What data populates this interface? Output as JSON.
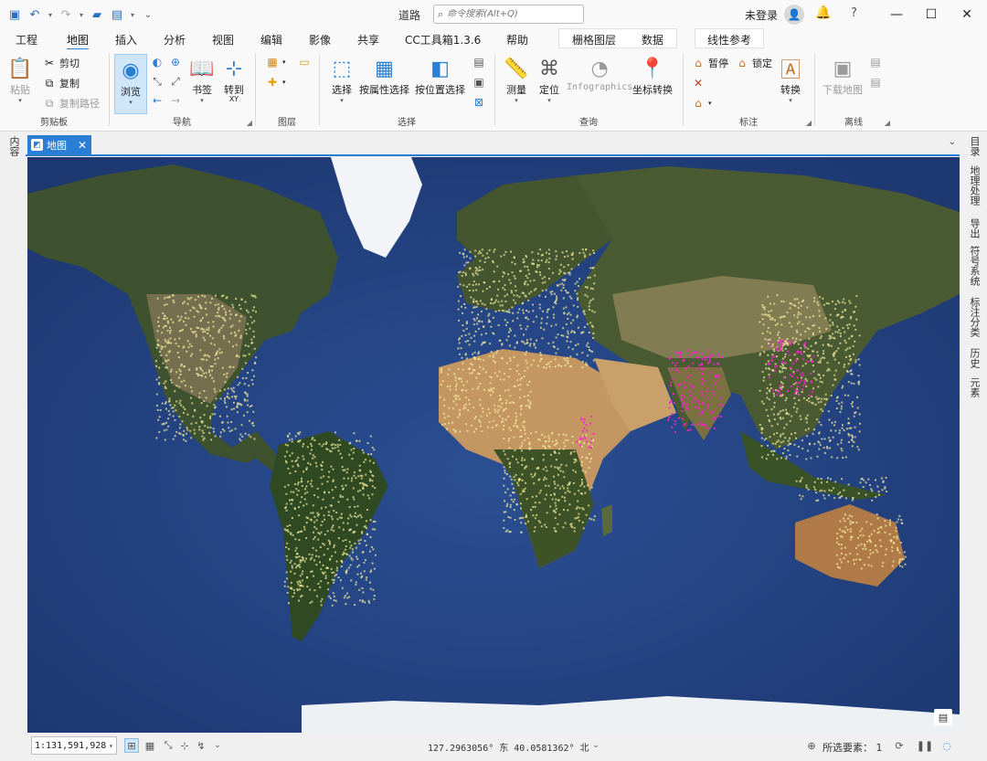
{
  "titlebar": {
    "title": "道路",
    "search_placeholder": "命令搜索(Alt+Q)",
    "login": "未登录",
    "icons": [
      "save-icon",
      "undo-icon",
      "redo-icon",
      "open-folder-icon",
      "new-project-icon",
      "customize-icon"
    ]
  },
  "menu": {
    "tabs": [
      "工程",
      "地图",
      "插入",
      "分析",
      "视图",
      "编辑",
      "影像",
      "共享",
      "CC工具箱1.3.6",
      "帮助"
    ],
    "active_tab": "地图",
    "context_tabs": [
      "栅格图层",
      "数据"
    ],
    "context_tab2": "线性参考"
  },
  "ribbon": {
    "clipboard": {
      "paste": "粘贴",
      "cut": "剪切",
      "copy": "复制",
      "copy_path": "复制路径",
      "label": "剪贴板"
    },
    "navigate": {
      "explore": "浏览",
      "bookmarks": "书签",
      "goto": "转到",
      "goto_sub": "XY",
      "label": "导航"
    },
    "layer": {
      "label": "图层"
    },
    "selection": {
      "select": "选择",
      "by_attr": "按属性选择",
      "by_loc": "按位置选择",
      "label": "选择"
    },
    "inquiry": {
      "measure": "测量",
      "locate": "定位",
      "infographics": "Infographics",
      "convert": "坐标转换",
      "label": "查询"
    },
    "labeling": {
      "pause": "暂停",
      "lock": "锁定",
      "convert": "转换",
      "label": "标注"
    },
    "offline": {
      "download": "下载地图",
      "label": "离线"
    }
  },
  "dock": {
    "left_label": "内容",
    "doc_tab": "地图",
    "right_labels": [
      "目录",
      "地理处理",
      "导出",
      "符号系统",
      "标注分类",
      "历史",
      "元素"
    ]
  },
  "status": {
    "scale": "1:131,591,928",
    "coordinates": "127.2963056° 东 40.0581362° 北",
    "selected_label": "所选要素：",
    "selected_count": "1"
  },
  "colors": {
    "accent": "#2a7fd4",
    "ocean": "#23407e",
    "land_forest": "#3a4f2c",
    "land_desert": "#b48a5a",
    "road_points": "#f7f0a0",
    "dense_points": "#ff1fd0",
    "ice": "#f4f6f8"
  }
}
